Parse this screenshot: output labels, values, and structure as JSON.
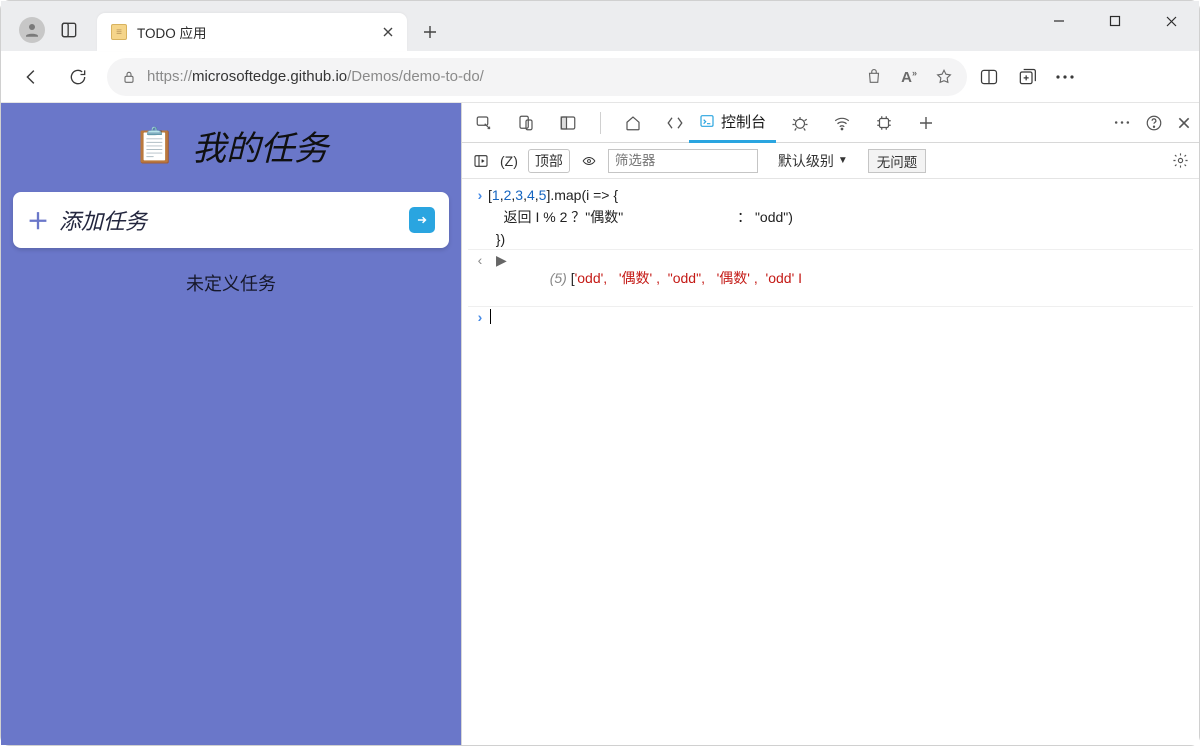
{
  "browser": {
    "tab_title": "TODO 应用",
    "url_prefix": "https://",
    "url_host": "microsoftedge.github.io",
    "url_path": "/Demos/demo-to-do/"
  },
  "page": {
    "title": "我的任务",
    "add_label": "添加任务",
    "empty_label": "未定义任务"
  },
  "devtools": {
    "console_tab_label": "控制台",
    "context_key": "(Z)",
    "context_label": "顶部",
    "filter_placeholder": "筛选器",
    "level_label": "默认级别",
    "issues_label": "无问题",
    "code_line1_a": "[",
    "code_line1_nums": [
      "1",
      "2",
      "3",
      "4",
      "5"
    ],
    "code_line1_b": "].map(i => {",
    "code_line2_a": "    返回 I % 2 ？\"偶数\"",
    "code_line2_b": " ： \"odd\")",
    "code_line3": "  })",
    "result_count": "(5)",
    "result_items": [
      "'odd',",
      "'偶数' ,",
      "\"odd\",",
      "'偶数' ,",
      "'odd' I"
    ]
  }
}
